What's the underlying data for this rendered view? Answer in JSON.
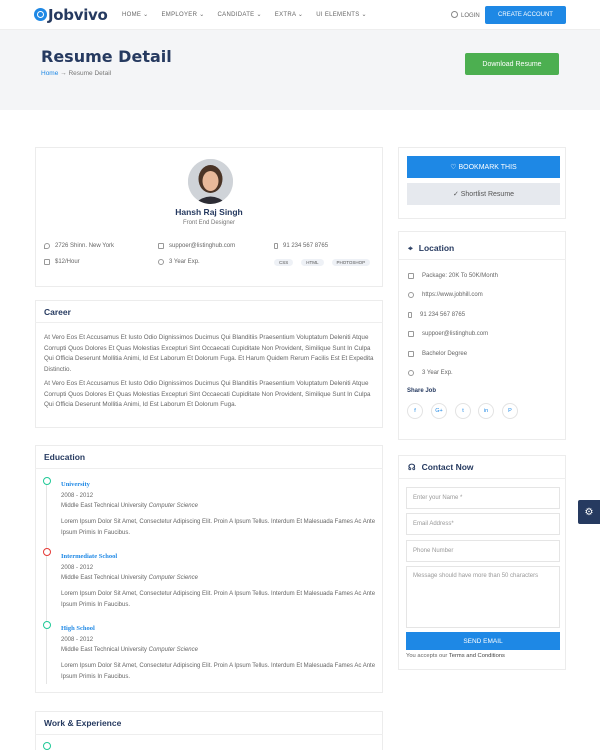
{
  "header": {
    "logo": "Jobvivo",
    "nav": [
      "HOME ⌄",
      "EMPLOYER ⌄",
      "CANDIDATE ⌄",
      "EXTRA ⌄",
      "UI ELEMENTS ⌄"
    ],
    "login": "LOGIN",
    "create_account": "CREATE ACCOUNT"
  },
  "banner": {
    "title": "Resume Detail",
    "breadcrumb_home": "Home",
    "breadcrumb_sep": " → ",
    "breadcrumb_current": "Resume Detail",
    "download": "Download Resume"
  },
  "profile": {
    "name": "Hansh Raj Singh",
    "role": "Front End Designer",
    "address": "2726 Shinn. New York",
    "email": "suppoer@listinghub.com",
    "phone": "91 234 567 8765",
    "rate": "$12/Hour",
    "experience": "3 Year Exp.",
    "skills": [
      "CSS",
      "HTML",
      "PHOTOSHOP"
    ]
  },
  "career": {
    "title": "Career",
    "p1": "At Vero Eos Et Accusamus Et Iusto Odio Dignissimos Ducimus Qui Blanditiis Praesentium Voluptatum Deleniti Atque Corrupti Quos Dolores Et Quas Molestias Excepturi Sint Occaecati Cupiditate Non Provident, Similique Sunt In Culpa Qui Officia Deserunt Mollitia Animi, Id Est Laborum Et Dolorum Fuga. Et Harum Quidem Rerum Facilis Est Et Expedita Distinctio.",
    "p2": "At Vero Eos Et Accusamus Et Iusto Odio Dignissimos Ducimus Qui Blanditiis Praesentium Voluptatum Deleniti Atque Corrupti Quos Dolores Et Quas Molestias Excepturi Sint Occaecati Cupiditate Non Provident, Similique Sunt In Culpa Qui Officia Deserunt Mollitia Animi, Id Est Laborum Et Dolorum Fuga."
  },
  "education": {
    "title": "Education",
    "items": [
      {
        "title": "University",
        "year": "2008 - 2012",
        "school": "Middle East Technical University",
        "field": "Computer Science",
        "desc": "Lorem Ipsum Dolor Sit Amet, Consectetur Adipiscing Elit. Proin A Ipsum Tellus. Interdum Et Malesuada Fames Ac Ante Ipsum Primis In Faucibus.",
        "color": "#20c997"
      },
      {
        "title": "Intermediate School",
        "year": "2008 - 2012",
        "school": "Middle East Technical University",
        "field": "Computer Science",
        "desc": "Lorem Ipsum Dolor Sit Amet, Consectetur Adipiscing Elit. Proin A Ipsum Tellus. Interdum Et Malesuada Fames Ac Ante Ipsum Primis In Faucibus.",
        "color": "#e53935"
      },
      {
        "title": "High School",
        "year": "2008 - 2012",
        "school": "Middle East Technical University",
        "field": "Computer Science",
        "desc": "Lorem Ipsum Dolor Sit Amet, Consectetur Adipiscing Elit. Proin A Ipsum Tellus. Interdum Et Malesuada Fames Ac Ante Ipsum Primis In Faucibus.",
        "color": "#20c997"
      }
    ]
  },
  "work": {
    "title": "Work & Experience"
  },
  "sidebar": {
    "bookmark": "♡ BOOKMARK THIS",
    "shortlist": "✓ Shortlist Resume",
    "location_title": "Location",
    "location_items": [
      {
        "icon": "package-icon",
        "text": "Package: 20K To 50K/Month"
      },
      {
        "icon": "globe-icon",
        "text": "https://www.jobhill.com"
      },
      {
        "icon": "phone-icon",
        "text": "91 234 567 8765"
      },
      {
        "icon": "mail-icon",
        "text": "suppoer@listinghub.com"
      },
      {
        "icon": "degree-icon",
        "text": "Bachelor Degree"
      },
      {
        "icon": "experience-icon",
        "text": "3 Year Exp."
      }
    ],
    "share_title": "Share Job",
    "social": [
      "f",
      "G+",
      "t",
      "in",
      "P"
    ],
    "contact_title": "Contact Now",
    "name_placeholder": "Enter your Name *",
    "email_placeholder": "Email Address*",
    "phone_placeholder": "Phone Number",
    "message_placeholder": "Message should have more than 50 characters",
    "send": "SEND EMAIL",
    "terms_prefix": "You accepts our ",
    "terms_link": "Terms and Conditions"
  },
  "colors": {
    "accent": "#1e88e5",
    "green": "#4caf50",
    "navy": "#263a60"
  }
}
